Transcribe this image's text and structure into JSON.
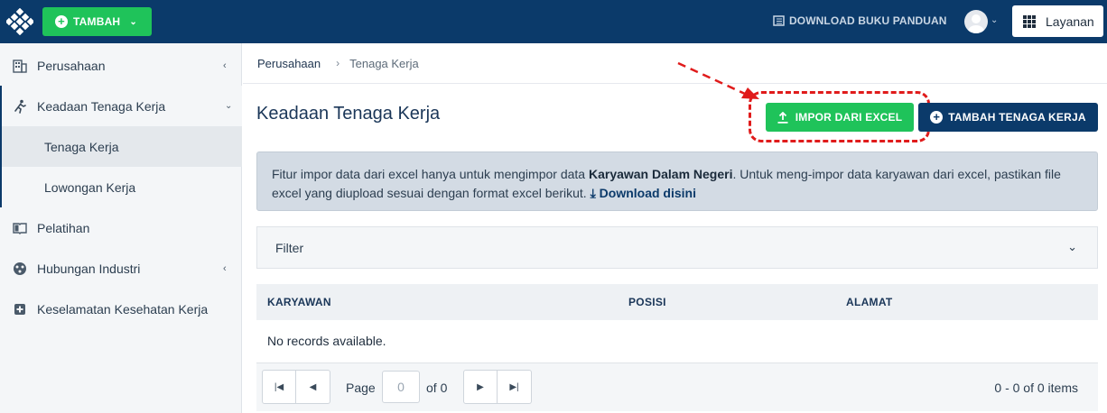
{
  "topbar": {
    "tambah_label": "TAMBAH",
    "download_guide_label": "DOWNLOAD BUKU PANDUAN",
    "layanan_label": "Layanan"
  },
  "sidebar": {
    "items": [
      {
        "label": "Perusahaan",
        "icon": "building-icon"
      },
      {
        "label": "Keadaan Tenaga Kerja",
        "icon": "running-person-icon"
      },
      {
        "label": "Pelatihan",
        "icon": "book-icon"
      },
      {
        "label": "Hubungan Industri",
        "icon": "community-icon"
      },
      {
        "label": "Keselamatan Kesehatan Kerja",
        "icon": "medical-plus-icon"
      }
    ],
    "subitems": [
      {
        "label": "Tenaga Kerja"
      },
      {
        "label": "Lowongan Kerja"
      }
    ]
  },
  "breadcrumb": {
    "parent": "Perusahaan",
    "current": "Tenaga Kerja"
  },
  "page": {
    "title": "Keadaan Tenaga Kerja",
    "impor_label": "IMPOR DARI EXCEL",
    "tambah_tk_label": "TAMBAH TENAGA KERJA"
  },
  "info": {
    "text1": "Fitur impor data dari excel hanya untuk mengimpor data ",
    "bold": "Karyawan Dalam Negeri",
    "text2": ". Untuk meng-impor data karyawan dari excel, pastikan file excel yang diupload sesuai dengan format excel berikut. ",
    "download_label": "Download disini"
  },
  "filter": {
    "label": "Filter"
  },
  "table": {
    "columns": [
      "KARYAWAN",
      "POSISI",
      "ALAMAT"
    ],
    "empty_message": "No records available."
  },
  "pager": {
    "page_label": "Page",
    "page_value": "0",
    "of_label": "of 0",
    "items_info": "0 - 0 of 0 items"
  },
  "colors": {
    "navy": "#0b3a6a",
    "green": "#1fc35a",
    "highlight_red": "#e01b1b"
  }
}
